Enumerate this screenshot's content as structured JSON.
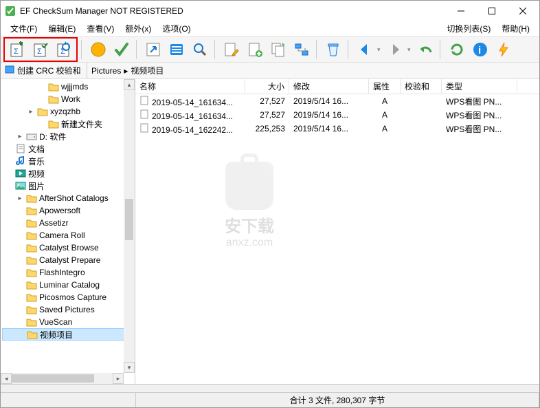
{
  "title": "EF CheckSum Manager NOT REGISTERED",
  "menubar": {
    "file": "文件(F)",
    "edit": "编辑(E)",
    "view": "查看(V)",
    "extra": "额外(x)",
    "options": "选项(O)",
    "switch_list": "切换列表(S)",
    "help": "帮助(H)"
  },
  "subbar": {
    "left_label": "创建 CRC 校验和",
    "crumb1": "Pictures",
    "crumb2": "视频项目"
  },
  "tree": [
    {
      "indent": 3,
      "expander": "",
      "icon": "folder",
      "label": "wjjjmds"
    },
    {
      "indent": 3,
      "expander": "",
      "icon": "folder",
      "label": "Work"
    },
    {
      "indent": 2,
      "expander": "▸",
      "icon": "folder",
      "label": "xyzqzhb"
    },
    {
      "indent": 3,
      "expander": "",
      "icon": "folder",
      "label": "新建文件夹"
    },
    {
      "indent": 1,
      "expander": "▸",
      "icon": "drive",
      "label": "D: 软件"
    },
    {
      "indent": 0,
      "expander": "",
      "icon": "doc",
      "label": "文档"
    },
    {
      "indent": 0,
      "expander": "",
      "icon": "music",
      "label": "音乐"
    },
    {
      "indent": 0,
      "expander": "",
      "icon": "video",
      "label": "视频"
    },
    {
      "indent": 0,
      "expander": "",
      "icon": "pic",
      "label": "图片"
    },
    {
      "indent": 1,
      "expander": "▸",
      "icon": "folder",
      "label": "AfterShot Catalogs"
    },
    {
      "indent": 1,
      "expander": "",
      "icon": "folder",
      "label": "Apowersoft"
    },
    {
      "indent": 1,
      "expander": "",
      "icon": "folder",
      "label": "Assetizr"
    },
    {
      "indent": 1,
      "expander": "",
      "icon": "folder",
      "label": "Camera Roll"
    },
    {
      "indent": 1,
      "expander": "",
      "icon": "folder",
      "label": "Catalyst Browse"
    },
    {
      "indent": 1,
      "expander": "",
      "icon": "folder",
      "label": "Catalyst Prepare"
    },
    {
      "indent": 1,
      "expander": "",
      "icon": "folder",
      "label": "FlashIntegro"
    },
    {
      "indent": 1,
      "expander": "",
      "icon": "folder",
      "label": "Luminar Catalog"
    },
    {
      "indent": 1,
      "expander": "",
      "icon": "folder",
      "label": "Picosmos Capture"
    },
    {
      "indent": 1,
      "expander": "",
      "icon": "folder",
      "label": "Saved Pictures"
    },
    {
      "indent": 1,
      "expander": "",
      "icon": "folder",
      "label": "VueScan"
    },
    {
      "indent": 1,
      "expander": "",
      "icon": "folder",
      "label": "视频项目",
      "selected": true
    }
  ],
  "columns": {
    "name": "名称",
    "size": "大小",
    "modified": "修改",
    "attr": "属性",
    "checksum": "校验和",
    "type": "类型"
  },
  "rows": [
    {
      "name": "2019-05-14_161634...",
      "size": "27,527",
      "modified": "2019/5/14 16...",
      "attr": "A",
      "checksum": "",
      "type": "WPS看图 PN..."
    },
    {
      "name": "2019-05-14_161634...",
      "size": "27,527",
      "modified": "2019/5/14 16...",
      "attr": "A",
      "checksum": "",
      "type": "WPS看图 PN..."
    },
    {
      "name": "2019-05-14_162242...",
      "size": "225,253",
      "modified": "2019/5/14 16...",
      "attr": "A",
      "checksum": "",
      "type": "WPS看图 PN..."
    }
  ],
  "status": "合计 3 文件,  280,307 字节",
  "watermark": {
    "line1": "安下载",
    "line2": "anxz.com"
  }
}
